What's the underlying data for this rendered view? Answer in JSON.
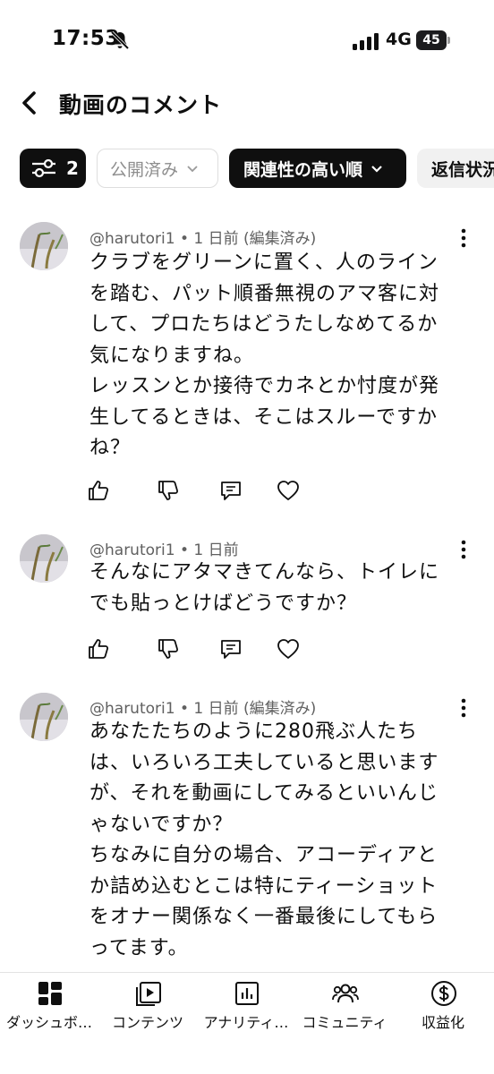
{
  "status_bar": {
    "time": "17:53",
    "network": "4G",
    "battery": "45"
  },
  "header": {
    "title": "動画のコメント"
  },
  "chips": {
    "filter_count": "2",
    "published": "公開済み",
    "sort": "関連性の高い順",
    "reply_status": "返信状況"
  },
  "comments": [
    {
      "author": "@harutori1",
      "time": "1 日前",
      "edited": "(編集済み)",
      "lines": [
        "クラブをグリーンに置く、人のライン",
        "を踏む、パット順番無視のアマ客に対",
        "して、プロたちはどうたしなめてるか",
        "気になりますね。",
        "レッスンとか接待でカネとか忖度が発",
        "生してるときは、そこはスルーですか",
        "ね？"
      ]
    },
    {
      "author": "@harutori1",
      "time": "1 日前",
      "edited": "",
      "lines": [
        "そんなにアタマきてんなら、トイレに",
        "でも貼っとけばどうですか？"
      ]
    },
    {
      "author": "@harutori1",
      "time": "1 日前",
      "edited": "(編集済み)",
      "lines": [
        "あなたたちのように280飛ぶ人たち",
        "は、いろいろ工夫していると思います",
        "が、それを動画にしてみるといいんじ",
        "ゃないですか？",
        "ちなみに自分の場合、アコーディアと",
        "か詰め込むとこは特にティーショット",
        "をオナー関係なく一番最後にしてもら",
        "ってます。"
      ]
    }
  ],
  "bottom_nav": [
    {
      "label": "ダッシュボ…",
      "icon": "dashboard-icon"
    },
    {
      "label": "コンテンツ",
      "icon": "content-icon"
    },
    {
      "label": "アナリティ…",
      "icon": "analytics-icon"
    },
    {
      "label": "コミュニティ",
      "icon": "community-icon"
    },
    {
      "label": "収益化",
      "icon": "monetization-icon"
    }
  ]
}
